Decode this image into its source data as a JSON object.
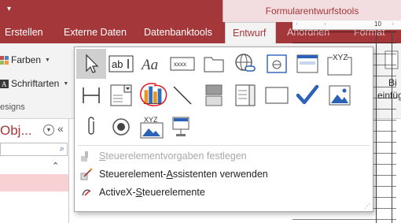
{
  "window": {
    "qat_dropdown": "▾",
    "context_header": "Formularentwurfstools"
  },
  "tabs": [
    {
      "label": "Erstellen"
    },
    {
      "label": "Externe Daten"
    },
    {
      "label": "Datenbanktools"
    },
    {
      "label": "Entwurf"
    },
    {
      "label": "Anordnen"
    },
    {
      "label": "Format"
    }
  ],
  "ribbon": {
    "farben_label": "Farben",
    "schriftarten_label": "Schriftarten",
    "group_label": "esigns",
    "right_label_1": "Bi",
    "right_label_2": "einfüg"
  },
  "controls_gallery": {
    "row1": [
      "select-pointer",
      "textbox",
      "label-aa",
      "button-xxxx",
      "tab-control",
      "hyperlink",
      "web-browser",
      "navigation",
      "option-group-xyz"
    ],
    "row2": [
      "page-break",
      "combo-box",
      "chart",
      "line",
      "toggle-button",
      "list-box",
      "rectangle",
      "check-box",
      "image"
    ],
    "row3": [
      "attachment",
      "option-button",
      "subform",
      "bound-object-frame"
    ],
    "xyz_label": "XYZ",
    "ab_label": "ab",
    "aa_label": "Aa",
    "xxxx_label": "xxxx",
    "highlight_color": "#e5141a"
  },
  "menu": {
    "item1": {
      "pre": "",
      "underlined": "S",
      "post": "teuerelementvorgaben festlegen",
      "disabled": true
    },
    "item2": {
      "pre": "Steuerelement-",
      "underlined": "A",
      "post": "ssistenten verwenden",
      "disabled": false
    },
    "item3": {
      "pre": "ActiveX-",
      "underlined": "S",
      "post": "teuerelemente",
      "disabled": false
    }
  },
  "navpane": {
    "title": "Obj...",
    "collapse": "«",
    "search_icon": "⌕",
    "scroll_up": "⌃"
  },
  "ruler": {
    "marks": [
      "·",
      "·",
      "10",
      "·"
    ]
  },
  "colors": {
    "access_accent": "#a4373a",
    "checkbox_blue": "#2b62b8",
    "chart_orange": "#e7961f",
    "chart_blue": "#2f6ec0"
  }
}
